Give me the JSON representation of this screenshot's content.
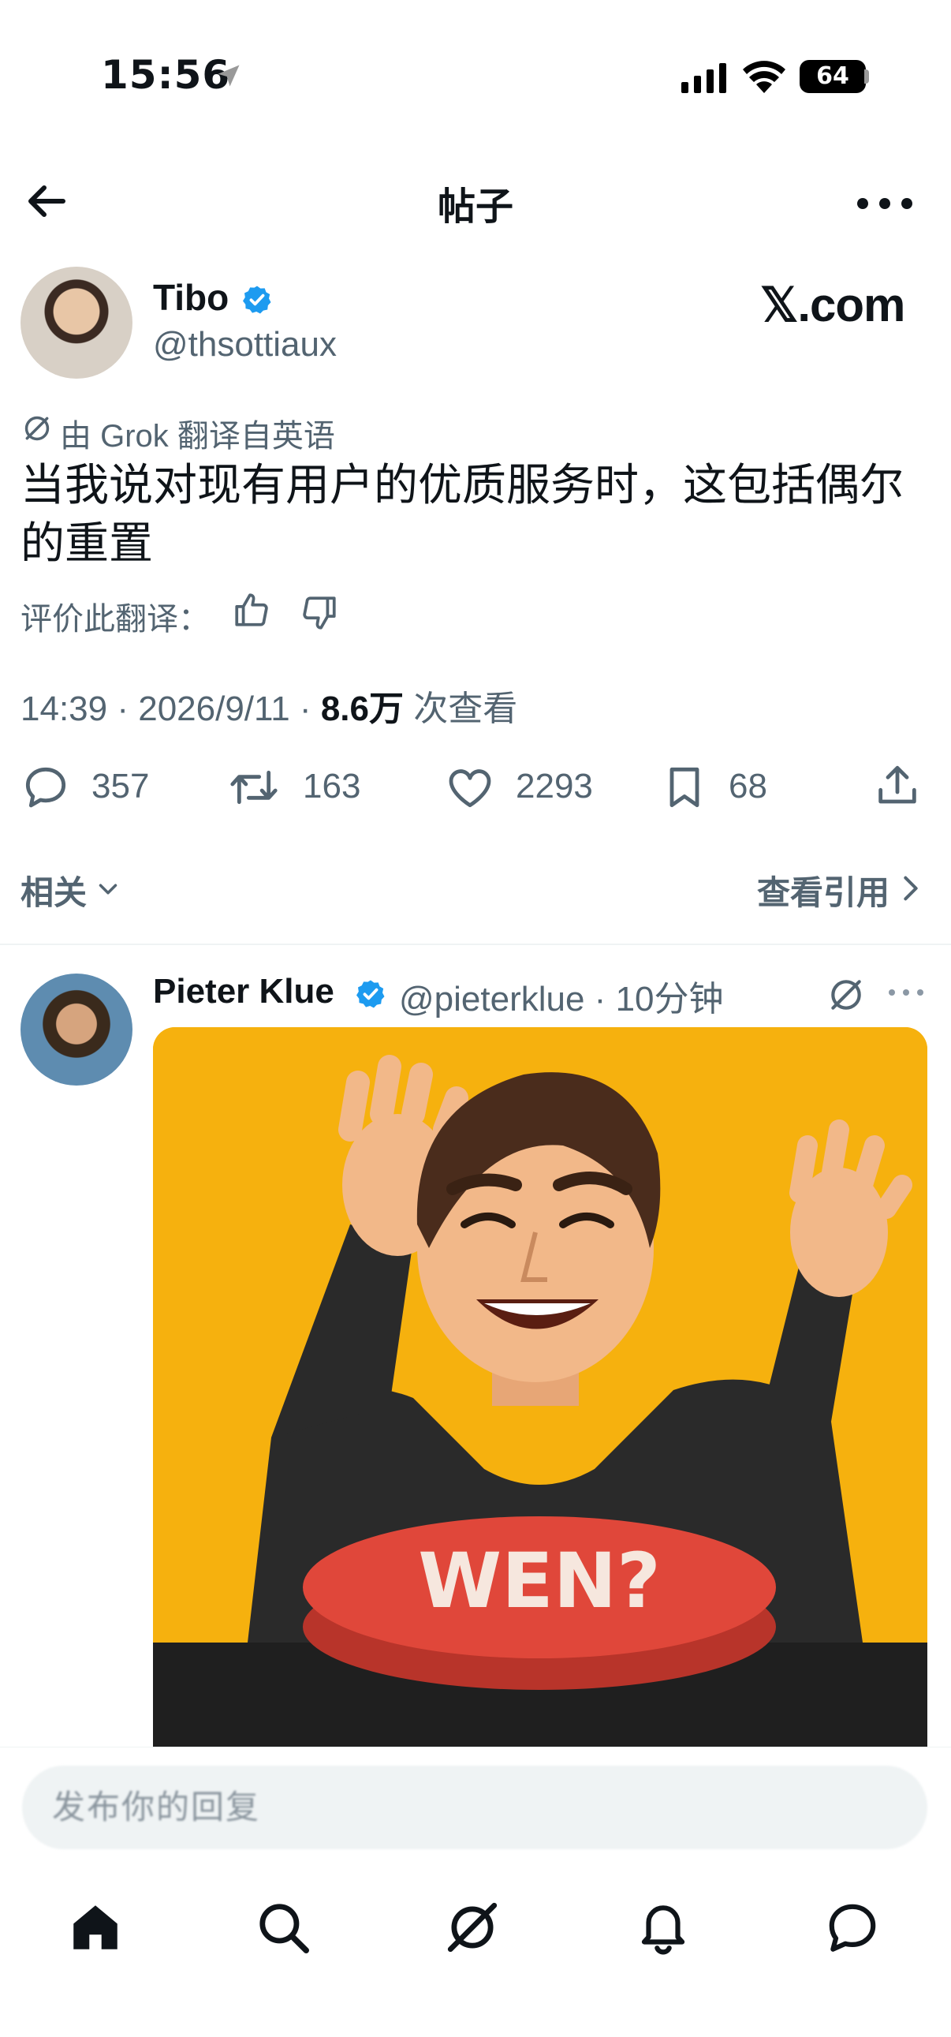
{
  "status_bar": {
    "time": "15:56",
    "battery": "64"
  },
  "header": {
    "title": "帖子"
  },
  "tweet": {
    "author_name": "Tibo",
    "author_handle": "@thsottiaux",
    "brand_logo": "𝕏.com",
    "translated_note": "由 Grok 翻译自英语",
    "text": "当我说对现有用户的优质服务时，这包括偶尔的重置",
    "rate_translation_label": "评价此翻译：",
    "time": "14:39",
    "date": "2026/9/11",
    "views": "8.6万",
    "views_suffix": "次查看",
    "counts": {
      "replies": "357",
      "reposts": "163",
      "likes": "2293",
      "bookmarks": "68"
    },
    "related_label": "相关",
    "view_quotes_label": "查看引用"
  },
  "reply": {
    "author_name": "Pieter Klue",
    "author_handle": "@pieterklue",
    "time_ago": "10分钟",
    "media_text": "WEN?"
  },
  "composer": {
    "placeholder": "发布你的回复"
  },
  "nav": {
    "items": [
      "home-icon",
      "search-icon",
      "grok-icon",
      "notifications-icon",
      "messages-icon"
    ]
  },
  "colors": {
    "text": "#0f1419",
    "secondary": "#536471",
    "verified": "#1d9bf0",
    "media_bg": "#f6b10e",
    "button_red": "#e0473a"
  }
}
